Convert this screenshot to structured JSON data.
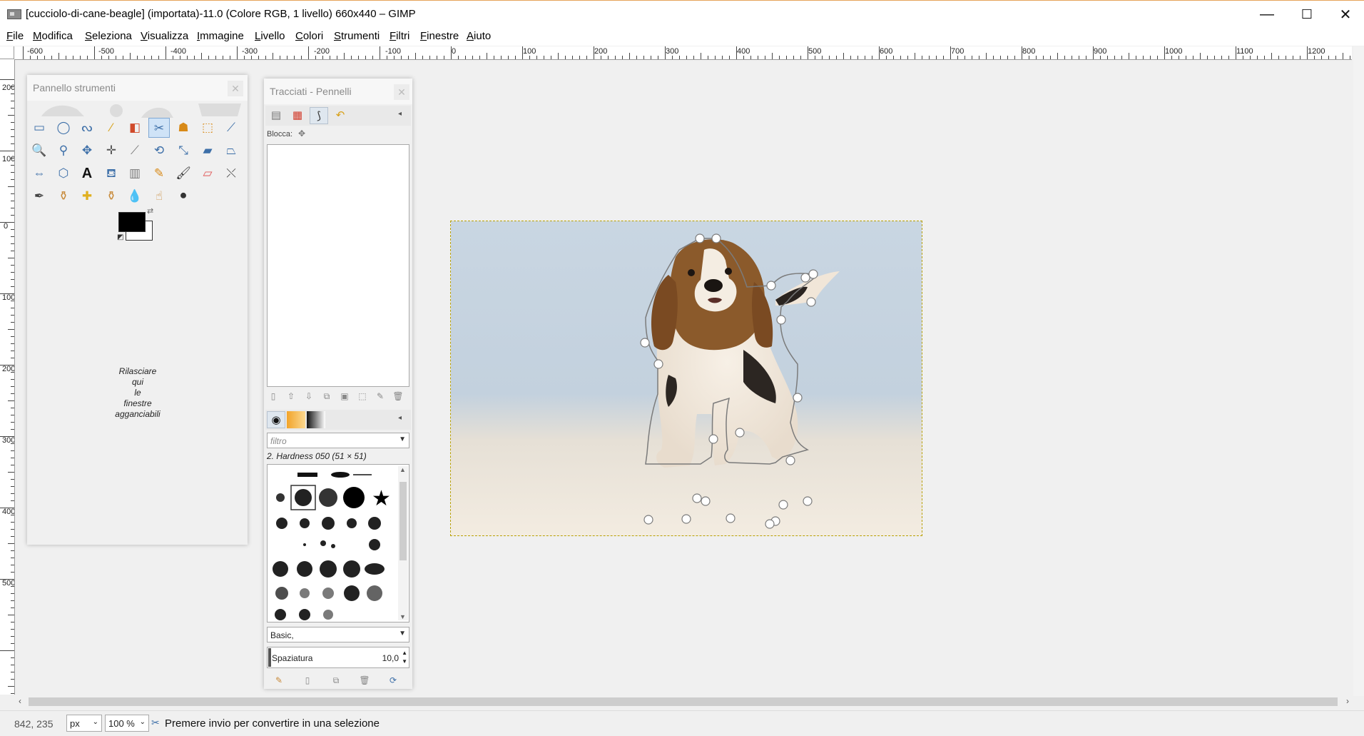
{
  "window": {
    "title": "[cucciolo-di-cane-beagle] (importata)-11.0 (Colore RGB, 1 livello) 660x440 – GIMP",
    "minimize": "—",
    "maximize": "☐",
    "close": "✕"
  },
  "menu": [
    "File",
    "Modifica",
    "Seleziona",
    "Visualizza",
    "Immagine",
    "Livello",
    "Colori",
    "Strumenti",
    "Filtri",
    "Finestre",
    "Aiuto"
  ],
  "ruler": {
    "h_labels": [
      "-600",
      "-500",
      "-400",
      "-300",
      "-200",
      "-100",
      "0",
      "100",
      "200",
      "300",
      "400",
      "500",
      "600",
      "700",
      "800",
      "900",
      "1000",
      "1100",
      "1200"
    ],
    "v_labels": [
      "200",
      "100",
      "0",
      "100",
      "200",
      "300",
      "400",
      "500"
    ]
  },
  "toolbox": {
    "title": "Pannello strumenti",
    "close": "✕",
    "dock_message": [
      "Rilasciare",
      "qui",
      "le",
      "finestre",
      "agganciabili"
    ],
    "fg_color": "#000000",
    "bg_color": "#ffffff"
  },
  "paths_panel": {
    "title": "Tracciati - Pennelli",
    "close": "✕",
    "lock_label": "Blocca:",
    "filter_placeholder": "filtro",
    "brush_name": "2. Hardness 050 (51 × 51)",
    "brush_set": "Basic,",
    "spacing_label": "Spaziatura",
    "spacing_value": "10,0"
  },
  "status": {
    "coords": "842, 235",
    "unit": "px",
    "zoom": "100 %",
    "message": "Premere invio per convertire in una selezione"
  },
  "canvas": {
    "width": 660,
    "height": 440
  },
  "colors": {
    "accent": "#3d6fa8",
    "selection_outline": "#b8a000",
    "path": "#808080"
  }
}
